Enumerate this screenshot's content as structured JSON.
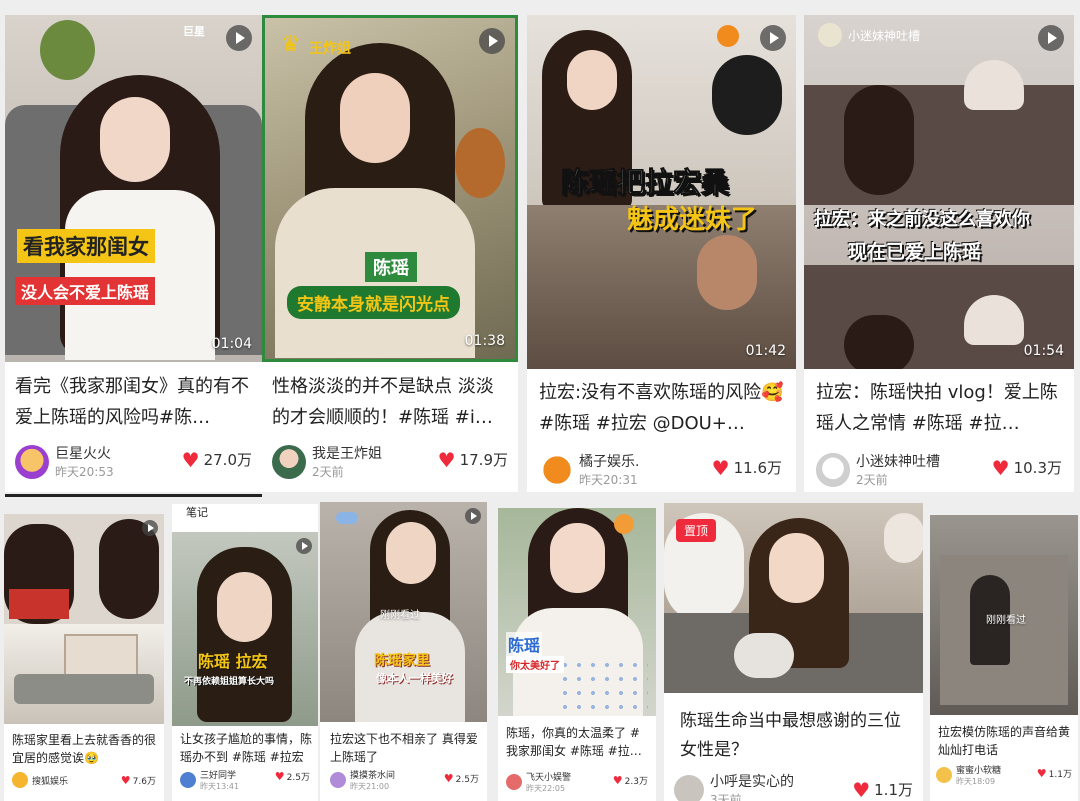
{
  "top_cards": [
    {
      "title": "看完《我家那闺女》真的有不爱上陈瑶的风险吗#陈…",
      "duration": "01:04",
      "author": "巨星火火",
      "time": "昨天20:53",
      "likes": "27.0万",
      "cap1": "看我家那闺女",
      "cap2": "没人会不爱上陈瑶",
      "logo": "巨星"
    },
    {
      "title": "性格淡淡的并不是缺点 淡淡的才会顺顺的！#陈瑶 #i…",
      "duration": "01:38",
      "author": "我是王炸姐",
      "time": "2天前",
      "likes": "17.9万",
      "badge": "王炸姐",
      "cap_name": "陈瑶",
      "cap_green": "安静本身就是闪光点"
    },
    {
      "title": "拉宏:没有不喜欢陈瑶的风险🥰 #陈瑶 #拉宏 @DOU+…",
      "duration": "01:42",
      "author": "橘子娱乐.",
      "time": "昨天20:31",
      "likes": "11.6万",
      "cap_big1": "陈瑶把拉宏桑",
      "cap_big2": "魅成迷妹了"
    },
    {
      "title": "拉宏：陈瑶快拍 vlog！爱上陈瑶人之常情 #陈瑶 #拉…",
      "duration": "01:54",
      "author": "小迷妹神吐槽",
      "time": "2天前",
      "likes": "10.3万",
      "badge": "小迷妹神吐槽",
      "cap_w1": "拉宏：来之前没这么喜欢你",
      "cap_w2": "现在已爱上陈瑶"
    }
  ],
  "bottom_cards": [
    {
      "title": "陈瑶家里看上去就香香的很宜居的感觉诶🥹",
      "author": "搜狐娱乐",
      "time": "",
      "likes": "7.6万"
    },
    {
      "title": "让女孩子尴尬的事情，陈瑶办不到 #陈瑶 #拉宏 …",
      "author": "三好同学",
      "time": "昨天13:41",
      "likes": "2.5万",
      "note": "笔记",
      "cap1": "陈瑶 拉宏",
      "cap2": "不再依赖姐姐算长大吗"
    },
    {
      "title": "拉宏这下也不相亲了 真得爱上陈瑶了",
      "author": "摸摸茶水间",
      "time": "昨天21:00",
      "likes": "2.5万",
      "seen": "刚刚看过",
      "cap1": "陈瑶家里",
      "cap2": "像本人一样美好"
    },
    {
      "title": "陈瑶，你真的太温柔了 #我家那闺女 #陈瑶 #拉…",
      "author": "飞天小娱警",
      "time": "昨天22:05",
      "likes": "2.3万",
      "cap1": "陈瑶",
      "cap2": "你太美好了"
    },
    {
      "title": "陈瑶生命当中最想感谢的三位女性是？",
      "author": "小呼是实心的",
      "time": "3天前",
      "likes": "1.1万",
      "pin": "置顶"
    },
    {
      "title": "拉宏模仿陈瑶的声音给黄灿灿打电话",
      "author": "蜜蜜小软糖",
      "time": "昨天18:09",
      "likes": "1.1万",
      "seen": "刚刚看过"
    }
  ]
}
